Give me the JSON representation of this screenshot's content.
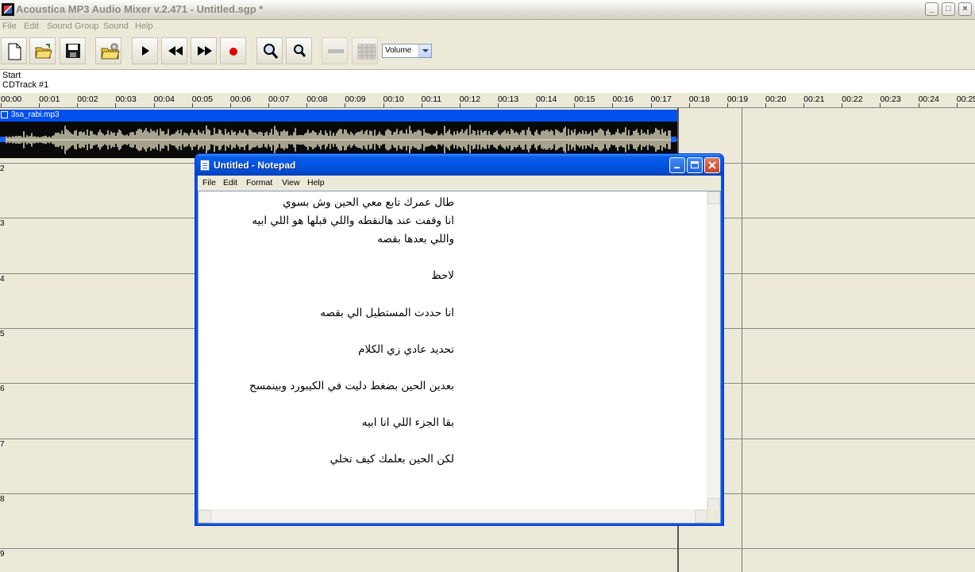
{
  "app": {
    "title": "Acoustica MP3 Audio Mixer v.2.471 - Untitled.sgp *",
    "window_buttons": [
      "_",
      "□",
      "×"
    ]
  },
  "menu": [
    "File",
    "Edit",
    "Sound Group",
    "Sound",
    "Help"
  ],
  "toolbar": {
    "buttons": [
      "new-file",
      "open-folder",
      "save",
      "open-cd",
      "play",
      "rewind",
      "fast-forward",
      "record",
      "zoom-in",
      "zoom-out",
      "disabled-bar",
      "grid"
    ],
    "volume_label": "Volume"
  },
  "track_header": {
    "start_label": "Start",
    "cd_track_label": "CDTrack #1"
  },
  "ruler": [
    "00:00",
    "00:01",
    "00:02",
    "00:03",
    "00:04",
    "00:05",
    "00:06",
    "00:07",
    "00:08",
    "00:09",
    "00:10",
    "00:11",
    "00:12",
    "00:13",
    "00:14",
    "00:15",
    "00:16",
    "00:17",
    "00:18",
    "00:19",
    "00:20",
    "00:21",
    "00:22",
    "00:23",
    "00:24",
    "00:25"
  ],
  "tracks": {
    "numbers": [
      "2",
      "3",
      "4",
      "5",
      "6",
      "7",
      "8",
      "9"
    ],
    "clip_name": "3sa_rabi.mp3"
  },
  "notepad": {
    "title": "Untitled - Notepad",
    "menu": [
      "File",
      "Edit",
      "Format",
      "View",
      "Help"
    ],
    "text": "طال عمرك تابع معي الحين وش بسوي\nانا وقفت عند هالنقطه واللي قبلها هو اللي ابيه\nواللي بعدها بقصه\n\nلاحظ\n\nانا حددت المستطيل الي بقصه\n\nتحديد عادي زي الكلام\n\nبعدين الحين بضغط دليت في الكيبورد وبينمسح\n\nبقا الجزء اللي انا ابيه\n\nلكن الحين بعلمك كيف تخلي"
  },
  "colors": {
    "clip_header": "#0050ee",
    "waveform": "#e9e6c8",
    "xp_blue": "#0054e3",
    "record": "#e00000"
  }
}
